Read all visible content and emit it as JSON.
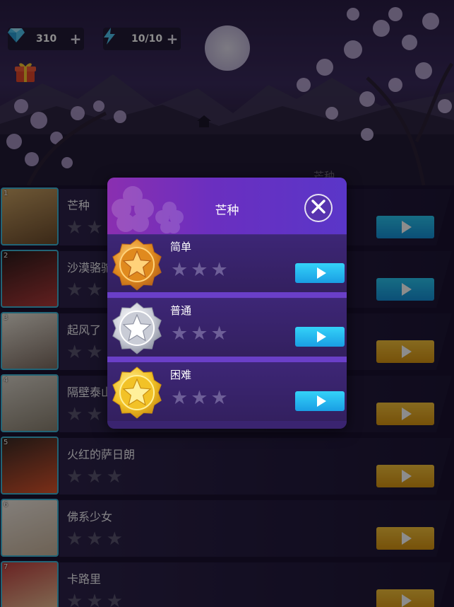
{
  "resources": {
    "gems": {
      "icon": "diamond-icon",
      "value": "310",
      "plus": "+"
    },
    "energy": {
      "icon": "lightning-icon",
      "value": "10/10",
      "plus": "+"
    },
    "gift_icon": "gift-icon"
  },
  "list_header_hint": "芒种",
  "songs": [
    {
      "index": "1",
      "title": "芒种",
      "stars": 3,
      "play": "blue"
    },
    {
      "index": "2",
      "title": "沙漠骆驼",
      "stars": 3,
      "play": "blue"
    },
    {
      "index": "3",
      "title": "起风了",
      "stars": 3,
      "play": "gold"
    },
    {
      "index": "4",
      "title": "隔壁泰山",
      "stars": 3,
      "play": "gold"
    },
    {
      "index": "5",
      "title": "火红的萨日朗",
      "stars": 3,
      "play": "gold"
    },
    {
      "index": "6",
      "title": "佛系少女",
      "stars": 3,
      "play": "gold"
    },
    {
      "index": "7",
      "title": "卡路里",
      "stars": 3,
      "play": "gold"
    }
  ],
  "modal": {
    "title": "芒种",
    "close_icon": "close-icon",
    "difficulties": [
      {
        "name": "简单",
        "medal": "bronze",
        "stars": 3
      },
      {
        "name": "普通",
        "medal": "silver",
        "stars": 3
      },
      {
        "name": "困难",
        "medal": "gold",
        "stars": 3
      }
    ]
  },
  "colors": {
    "play_blue": "#1ea8e6",
    "play_gold": "#e6a923",
    "modal_bg": "#3a2470",
    "accent_cyan": "#3fb6d8"
  }
}
